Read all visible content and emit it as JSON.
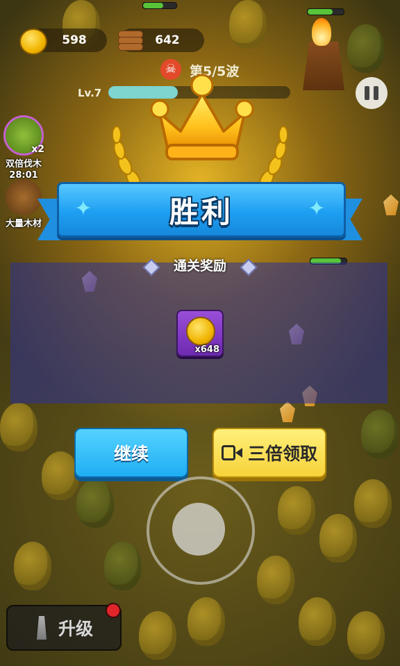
{
  "hud": {
    "gold": "598",
    "wood": "642",
    "wave_text": "第5/5波",
    "level": "Lv.7",
    "level_progress": 0.38
  },
  "side_buttons": {
    "double_wood": {
      "badge": "x2",
      "label": "双倍伐木",
      "timer": "28:01"
    },
    "bulk_wood": {
      "label": "大量木材"
    }
  },
  "victory": {
    "title": "胜利",
    "reward_title": "通关奖励",
    "reward_item": {
      "icon": "gold-coin-icon",
      "quantity": "x648"
    }
  },
  "buttons": {
    "continue_label": "继续",
    "triple_label": "三倍领取",
    "upgrade_label": "升级"
  },
  "colors": {
    "ribbon": "#1e9ff2",
    "continue_button": "#1faef4",
    "triple_button": "#f7d23a",
    "reward_panel": "#2d3296",
    "item_card": "#7d35c0"
  }
}
